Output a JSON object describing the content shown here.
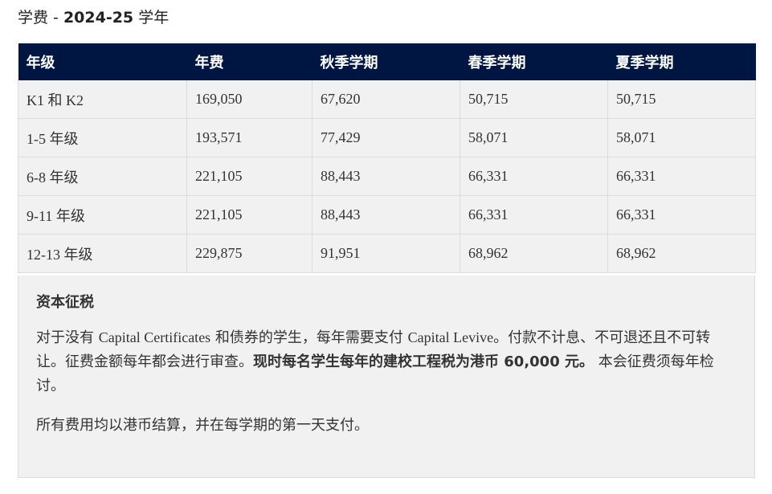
{
  "title": {
    "prefix": "学费 - ",
    "year": "2024-25",
    "suffix": " 学年"
  },
  "table": {
    "headers": [
      "年级",
      "年费",
      "秋季学期",
      "春季学期",
      "夏季学期"
    ],
    "rows": [
      [
        "K1 和 K2",
        "169,050",
        "67,620",
        "50,715",
        "50,715"
      ],
      [
        "1-5 年级",
        "193,571",
        "77,429",
        "58,071",
        "58,071"
      ],
      [
        "6-8 年级",
        "221,105",
        "88,443",
        "66,331",
        "66,331"
      ],
      [
        "9-11 年级",
        "221,105",
        "88,443",
        "66,331",
        "66,331"
      ],
      [
        "12-13 年级",
        "229,875",
        "91,951",
        "68,962",
        "68,962"
      ]
    ]
  },
  "levy": {
    "title": "资本征税",
    "text_1": "对于没有 ",
    "text_latin_1": "Capital Certificates",
    "text_2": " 和债券的学生，每年需要支付 ",
    "text_latin_2": "Capital Levive",
    "text_3": "。付款不计息、不可退还且不可转让。征费金额每年都会进行审查。",
    "text_bold": "现时每名学生每年的建校工程税为港币 60,000 元。",
    "text_4": " 本会征费须每年检讨。",
    "note": "所有费用均以港币结算，并在每学期的第一天支付。"
  }
}
